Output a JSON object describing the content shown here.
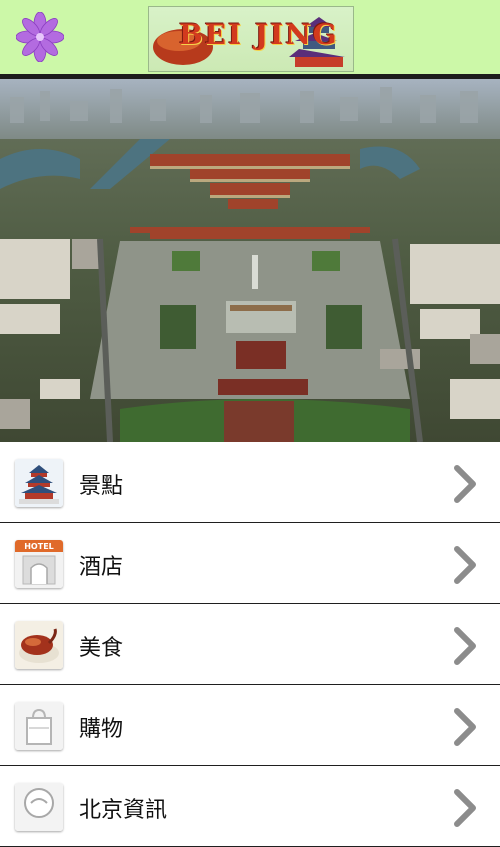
{
  "app": {
    "banner_text": "BEI JING",
    "colors": {
      "header_bg": "#ccf8a8",
      "divider": "#1c1c1c",
      "chevron": "#8c8c8c"
    }
  },
  "hero": {
    "icon": "forbidden-city-aerial-photo"
  },
  "menu": {
    "items": [
      {
        "label": "景點",
        "icon": "temple-of-heaven-icon"
      },
      {
        "label": "酒店",
        "icon": "hotel-icon"
      },
      {
        "label": "美食",
        "icon": "roast-duck-icon"
      },
      {
        "label": "購物",
        "icon": "shopping-bag-icon"
      },
      {
        "label": "北京資訊",
        "icon": "info-icon"
      }
    ]
  }
}
